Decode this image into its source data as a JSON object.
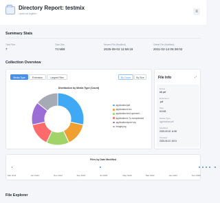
{
  "header": {
    "title": "Directory Report: testmix",
    "subtitle": "<path not legible>"
  },
  "summary": {
    "section_title": "Summary Stats",
    "stats": [
      {
        "label": "Total Files",
        "value": "7"
      },
      {
        "label": "Total Size",
        "value": "74 MiB"
      },
      {
        "label": "Newest File (Modified)",
        "value": "2025-09-02 11:58:19"
      },
      {
        "label": "Oldest File (Modified)",
        "value": "2011-02-14 05:38:02"
      }
    ]
  },
  "collection": {
    "section_title": "Collection Overview",
    "tabs": [
      "Media Type",
      "Extension",
      "Largest Files"
    ],
    "active_tab": 0,
    "toggles": [
      "By Count",
      "By Size"
    ],
    "active_toggle": 0
  },
  "chart_data": {
    "type": "pie",
    "title": "Distribution by Media Type (Count)",
    "donut": true,
    "categories": [
      "application/pdf",
      "application/x-tex",
      "application/vnd.openxml...",
      "application/x-7z-compressed",
      "application/epub+zip",
      "image/png"
    ],
    "values": [
      2,
      1,
      1,
      1,
      1,
      1
    ],
    "colors": [
      "#3fa9f5",
      "#f0a030",
      "#a0d468",
      "#ff6b6b",
      "#9b6dd6",
      "#a5aab5"
    ]
  },
  "file_info": {
    "title": "File Info",
    "fields": [
      {
        "label": "Name",
        "value": "bill.pdf"
      },
      {
        "label": "Extension",
        "value": ".pdf"
      },
      {
        "label": "Size",
        "value": "60 KiB"
      },
      {
        "label": "Media Type",
        "value": "application/pdf"
      },
      {
        "label": "Modified",
        "value": "2025-09-02 11:58"
      },
      {
        "label": "Created",
        "value": "2025-06-10 16:01"
      }
    ]
  },
  "timeline": {
    "title": "Files by Date Modified",
    "ticks": [
      "Mar 2011",
      "Jan 2013",
      "Nov 2014",
      "Sep 2016",
      "Jul 2018",
      "May 2020",
      "Mar 2022",
      "Jan 2024",
      "Nov 2025"
    ],
    "dot_color": "#4a90e2"
  },
  "explorer": {
    "section_title": "File Explorer"
  }
}
